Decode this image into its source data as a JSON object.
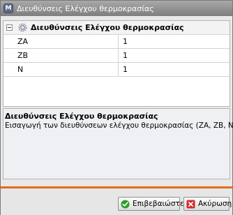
{
  "window": {
    "title": "Διευθύνσεις Ελέγχου θερμοκρασίας"
  },
  "grid": {
    "category": "Διευθύνσεις Ελέγχου θερμοκρασίας",
    "rows": [
      {
        "name": "ZA",
        "value": "1"
      },
      {
        "name": "ZB",
        "value": "1"
      },
      {
        "name": "N",
        "value": "1"
      }
    ]
  },
  "help": {
    "title": "Διευθύνσεις Ελέγχου θερμοκρασίας",
    "description": "Εισαγωγή των διευθύνσεων ελέγχου θερμοκρασίας (ZA, ZB, N)"
  },
  "buttons": {
    "confirm_label": "Επιβεβαιώστε",
    "cancel_label": "Ακύρωση"
  },
  "colors": {
    "accent": "#e36b21",
    "confirm_icon": "#2f9e2f",
    "cancel_icon": "#d42b2b"
  },
  "icons": {
    "app": "app-icon",
    "category": "gear-icon",
    "confirm": "check-icon",
    "cancel": "close-icon"
  }
}
